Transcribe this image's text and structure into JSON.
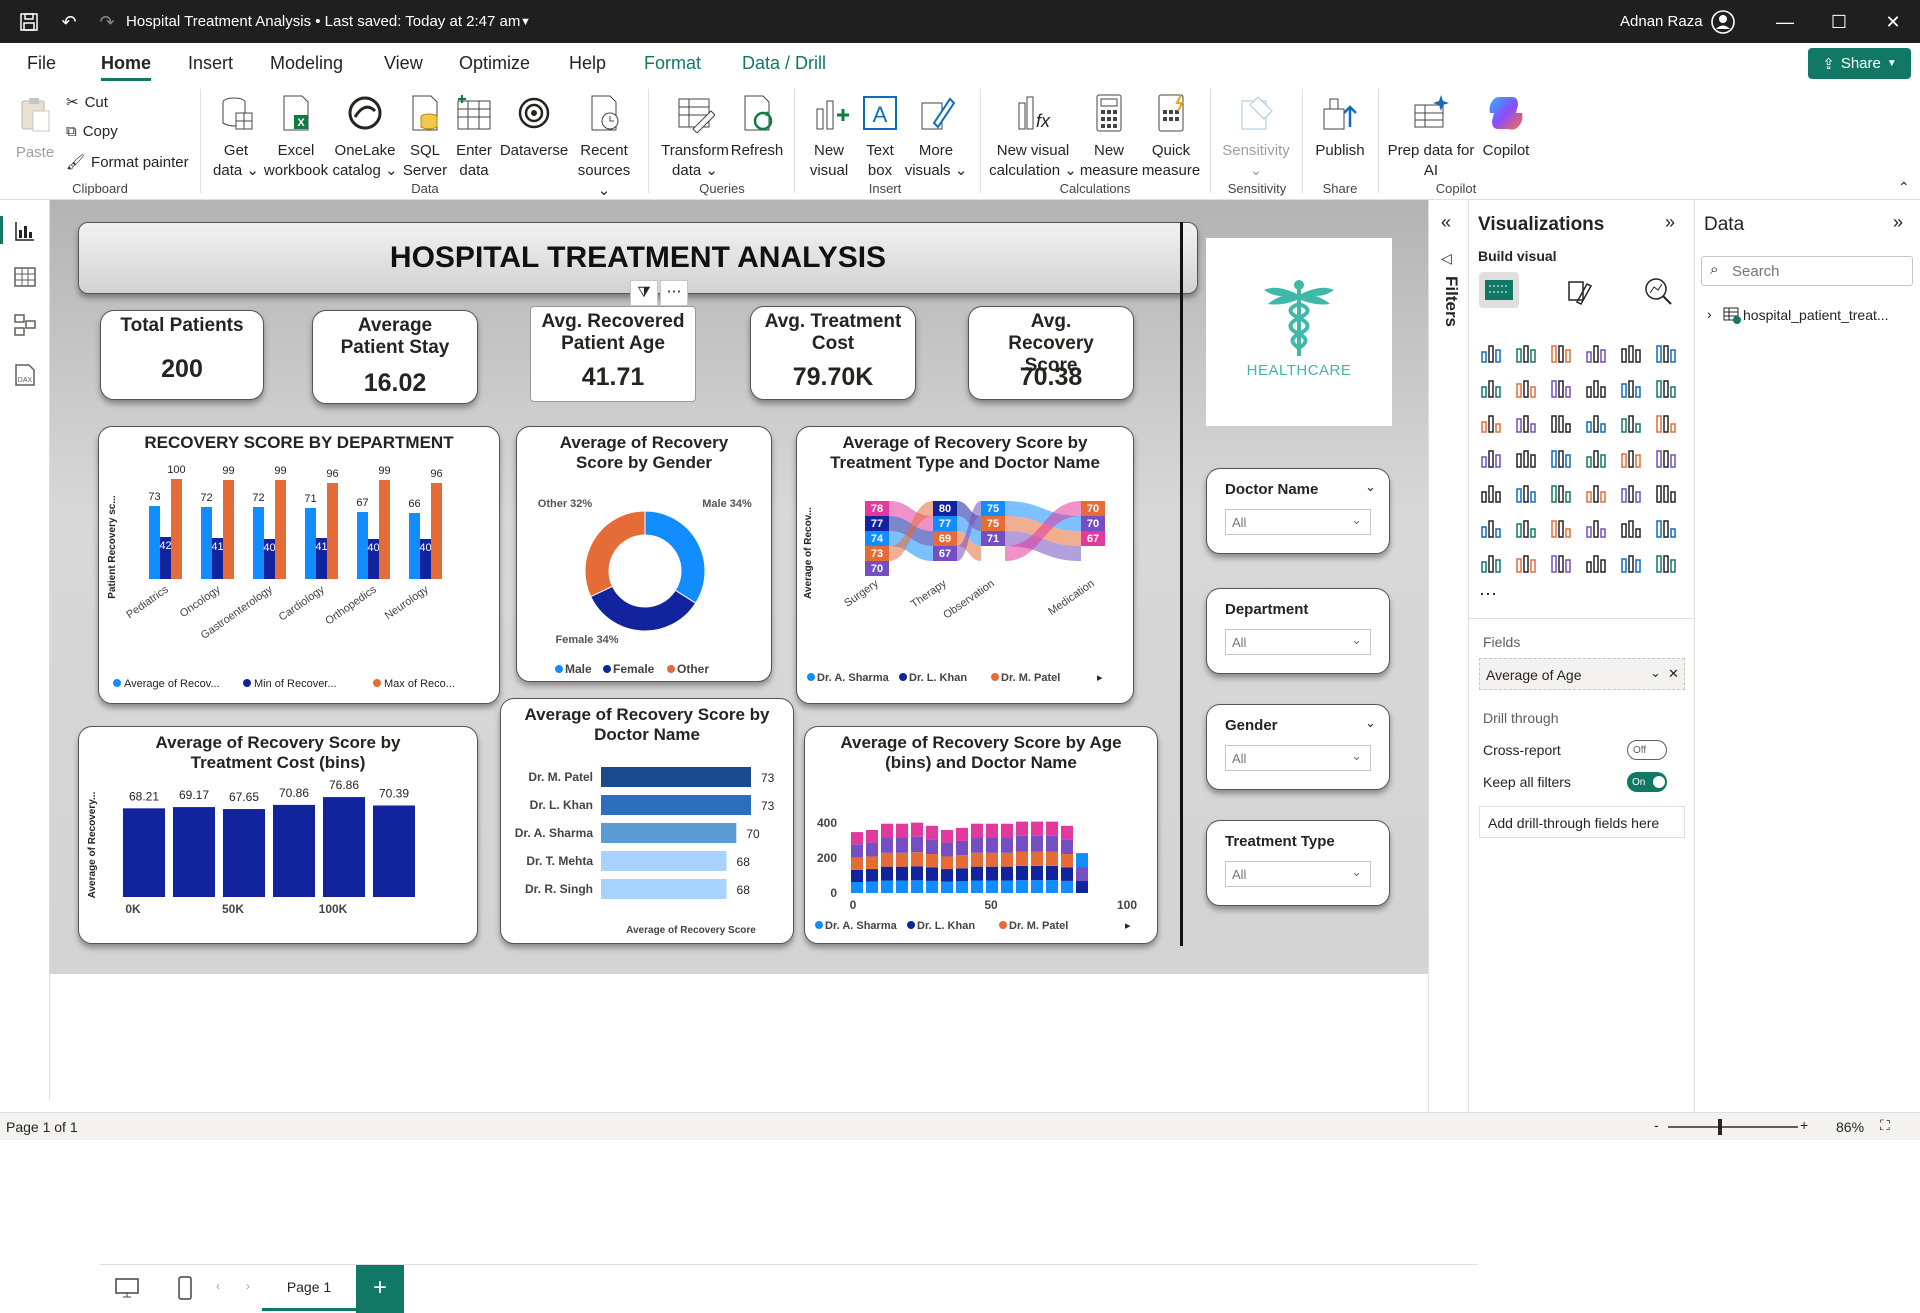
{
  "window": {
    "title": "Hospital Treatment Analysis • Last saved: Today at 2:47 am",
    "user": "Adnan Raza"
  },
  "menu": {
    "file": "File",
    "home": "Home",
    "insert": "Insert",
    "modeling": "Modeling",
    "view": "View",
    "optimize": "Optimize",
    "help": "Help",
    "format": "Format",
    "data_drill": "Data / Drill",
    "share": "Share"
  },
  "ribbon": {
    "paste": "Paste",
    "cut": "Cut",
    "copy": "Copy",
    "format_painter": "Format painter",
    "clipboard": "Clipboard",
    "get_data_1": "Get",
    "get_data_2": "data",
    "excel_1": "Excel",
    "excel_2": "workbook",
    "onelake_1": "OneLake",
    "onelake_2": "catalog",
    "sql_1": "SQL",
    "sql_2": "Server",
    "enter_1": "Enter",
    "enter_2": "data",
    "dataverse": "Dataverse",
    "recent_1": "Recent",
    "recent_2": "sources",
    "data_group": "Data",
    "transform_1": "Transform",
    "transform_2": "data",
    "refresh": "Refresh",
    "queries": "Queries",
    "new_visual_1": "New",
    "new_visual_2": "visual",
    "text_box_1": "Text",
    "text_box_2": "box",
    "more_visuals_1": "More",
    "more_visuals_2": "visuals",
    "insert_group": "Insert",
    "new_calc_1": "New visual",
    "new_calc_2": "calculation",
    "new_measure_1": "New",
    "new_measure_2": "measure",
    "quick_measure_1": "Quick",
    "quick_measure_2": "measure",
    "calculations": "Calculations",
    "sensitivity": "Sensitivity",
    "sensitivity_group": "Sensitivity",
    "publish": "Publish",
    "share_group": "Share",
    "prep_1": "Prep data for",
    "prep_2": "AI",
    "copilot": "Copilot",
    "copilot_group": "Copilot"
  },
  "report": {
    "title": "HOSPITAL TREATMENT ANALYSIS",
    "logo_text": "HEALTHCARE",
    "kpis": [
      {
        "title": "Total Patients",
        "value": "200"
      },
      {
        "title": "Average Patient Stay",
        "value": "16.02"
      },
      {
        "title": "Avg. Recovered Patient Age",
        "value": "41.71"
      },
      {
        "title": "Avg. Treatment Cost",
        "value": "79.70K"
      },
      {
        "title": "Avg. Recovery Score",
        "value": "70.38"
      }
    ],
    "slicers": [
      {
        "title": "Doctor Name",
        "value": "All"
      },
      {
        "title": "Department",
        "value": "All"
      },
      {
        "title": "Gender",
        "value": "All"
      },
      {
        "title": "Treatment Type",
        "value": "All"
      }
    ],
    "colors": {
      "avg": "#118dff",
      "min": "#12239e",
      "max": "#e66c37",
      "other": "#e66c37"
    }
  },
  "chart_data": [
    {
      "id": "dept",
      "type": "bar",
      "title": "RECOVERY SCORE BY DEPARTMENT",
      "ylabel": "Patient Recovery sc...",
      "categories": [
        "Pediatrics",
        "Oncology",
        "Gastroenterology",
        "Cardiology",
        "Orthopedics",
        "Neurology"
      ],
      "series": [
        {
          "name": "Average of Recov...",
          "values": [
            73,
            72,
            72,
            71,
            67,
            66
          ]
        },
        {
          "name": "Min of Recover...",
          "values": [
            42,
            41,
            40,
            41,
            40,
            40
          ]
        },
        {
          "name": "Max of Reco...",
          "values": [
            100,
            99,
            99,
            96,
            99,
            96
          ]
        }
      ]
    },
    {
      "id": "gender",
      "type": "pie",
      "title": "Average of Recovery Score by Gender",
      "categories": [
        "Male",
        "Female",
        "Other"
      ],
      "values": [
        34,
        34,
        32
      ],
      "labels": [
        "Male 34%",
        "Female 34%",
        "Other 32%"
      ]
    },
    {
      "id": "ribbon",
      "type": "bar",
      "title": "Average of Recovery Score by Treatment Type and Doctor Name",
      "ylabel": "Average of Recov...",
      "categories": [
        "Surgery",
        "Therapy",
        "Observation",
        "Medication"
      ],
      "series": [
        {
          "name": "Dr. A. Sharma"
        },
        {
          "name": "Dr. L. Khan"
        },
        {
          "name": "Dr. M. Patel"
        }
      ],
      "stack_labels": [
        [
          "78",
          "77",
          "74",
          "73",
          "70"
        ],
        [
          "80",
          "77",
          "69",
          "67"
        ],
        [
          "75",
          "75",
          "71"
        ],
        [
          "70",
          "70",
          "67"
        ]
      ]
    },
    {
      "id": "cost",
      "type": "bar",
      "title": "Average of Recovery Score by Treatment Cost (bins)",
      "ylabel": "Average of Recovery...",
      "categories": [
        "0K",
        "",
        "50K",
        "",
        "100K",
        ""
      ],
      "x_ticks": [
        "0K",
        "50K",
        "100K"
      ],
      "values": [
        68.21,
        69.17,
        67.65,
        70.86,
        76.86,
        70.39
      ]
    },
    {
      "id": "doctor",
      "type": "bar",
      "title": "Average of Recovery Score by Doctor Name",
      "xlabel": "Average of Recovery Score",
      "categories": [
        "Dr. M. Patel",
        "Dr. L. Khan",
        "Dr. A. Sharma",
        "Dr. T. Mehta",
        "Dr. R. Singh"
      ],
      "values": [
        73,
        73,
        70,
        68,
        68
      ]
    },
    {
      "id": "age",
      "type": "bar",
      "title": "Average of Recovery Score by Age (bins) and Doctor Name",
      "x_ticks": [
        "0",
        "50",
        "100"
      ],
      "y_ticks": [
        "400",
        "200",
        "0"
      ],
      "ylim": [
        0,
        400
      ],
      "series": [
        {
          "name": "Dr. A. Sharma"
        },
        {
          "name": "Dr. L. Khan"
        },
        {
          "name": "Dr. M. Patel"
        }
      ],
      "totals": [
        290,
        300,
        330,
        330,
        335,
        320,
        300,
        310,
        330,
        330,
        330,
        340,
        340,
        340,
        320,
        190
      ]
    }
  ],
  "visualizations": {
    "title": "Visualizations",
    "build": "Build visual",
    "fields": "Fields",
    "field_value": "Average of Age",
    "drill_through": "Drill through",
    "cross_report": "Cross-report",
    "cross_state": "Off",
    "keep_filters": "Keep all filters",
    "keep_state": "On",
    "add_drill": "Add drill-through fields here"
  },
  "filters": {
    "title": "Filters"
  },
  "data_pane": {
    "title": "Data",
    "search_placeholder": "Search",
    "table": "hospital_patient_treat..."
  },
  "pages": {
    "page1": "Page 1"
  },
  "status": {
    "page": "Page 1 of 1",
    "zoom": "86%"
  }
}
